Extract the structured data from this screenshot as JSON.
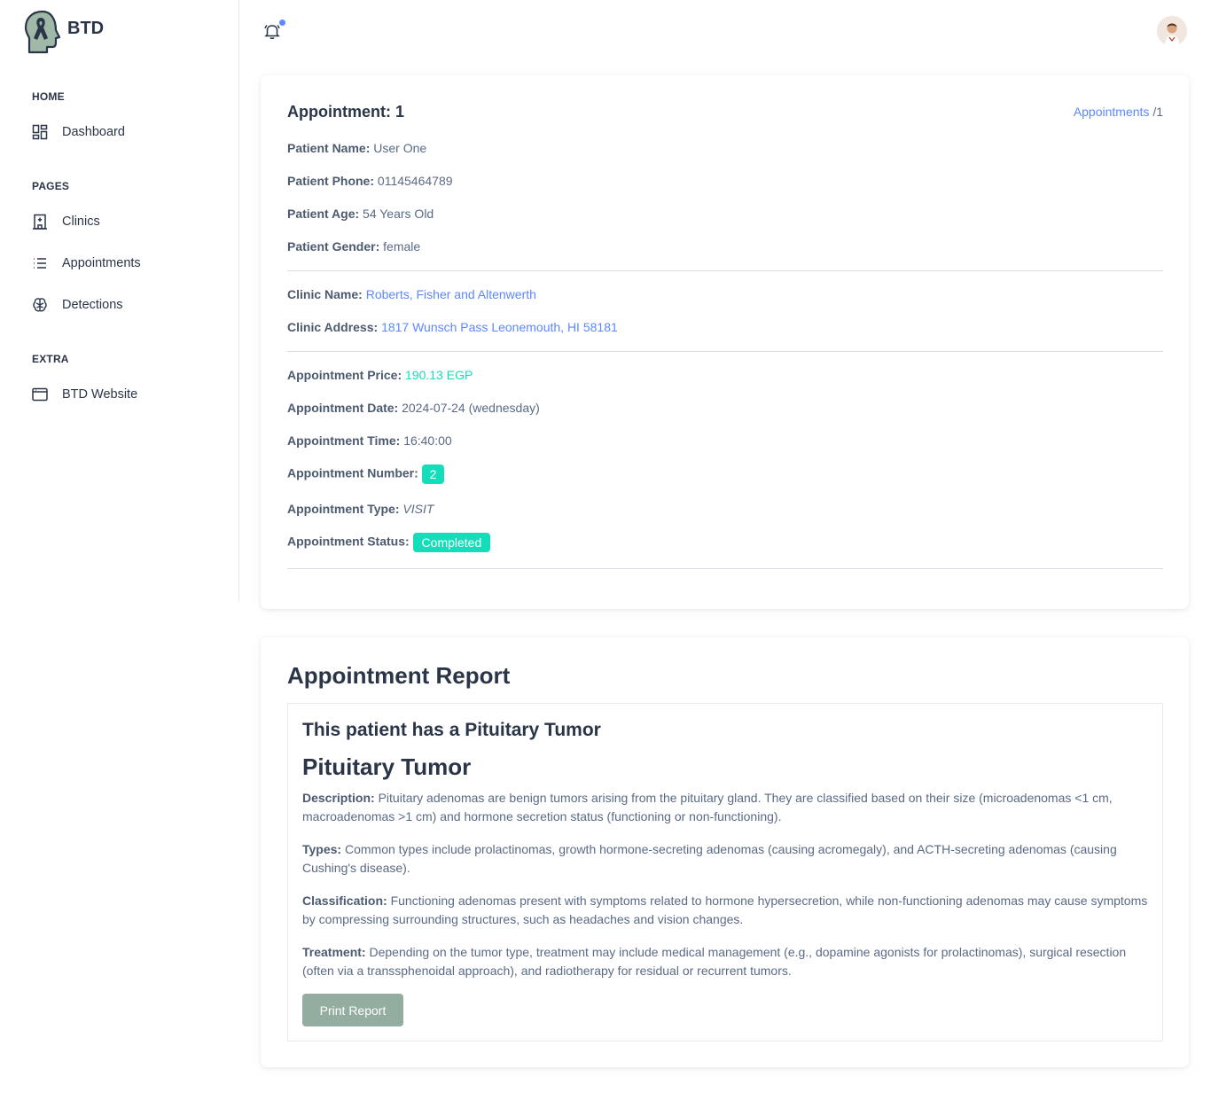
{
  "brand": {
    "name": "BTD"
  },
  "sidebar": {
    "sections": [
      {
        "title": "HOME"
      },
      {
        "title": "PAGES"
      },
      {
        "title": "EXTRA"
      }
    ],
    "items": [
      {
        "label": "Dashboard",
        "icon": "dashboard-icon"
      },
      {
        "label": "Clinics",
        "icon": "building-icon"
      },
      {
        "label": "Appointments",
        "icon": "list-icon"
      },
      {
        "label": "Detections",
        "icon": "brain-icon"
      },
      {
        "label": "BTD Website",
        "icon": "browser-icon"
      }
    ]
  },
  "topbar": {
    "bell_icon": "bell-icon",
    "avatar_icon": "user-avatar"
  },
  "appointment": {
    "title": "Appointment: 1",
    "breadcrumb": {
      "link": "Appointments",
      "separator": "/",
      "current": "1"
    },
    "patient": [
      {
        "label": "Patient Name:",
        "value": "User One"
      },
      {
        "label": "Patient Phone:",
        "value": "01145464789"
      },
      {
        "label": "Patient Age:",
        "value": "54 Years Old"
      },
      {
        "label": "Patient Gender:",
        "value": "female"
      }
    ],
    "clinic": [
      {
        "label": "Clinic Name:",
        "value": "Roberts, Fisher and Altenwerth"
      },
      {
        "label": "Clinic Address:",
        "value": "1817 Wunsch Pass Leonemouth, HI 58181"
      }
    ],
    "details": {
      "price_label": "Appointment Price:",
      "price": "190.13 EGP",
      "date_label": "Appointment Date:",
      "date": "2024-07-24 (wednesday)",
      "time_label": "Appointment Time:",
      "time": "16:40:00",
      "number_label": "Appointment Number:",
      "number": "2",
      "type_label": "Appointment Type:",
      "type": "VISIT",
      "status_label": "Appointment Status:",
      "status": "Completed"
    }
  },
  "report": {
    "title": "Appointment Report",
    "heading": "This patient has a Pituitary Tumor",
    "subtitle": "Pituitary Tumor",
    "paragraphs": [
      {
        "label": "Description:",
        "text": "Pituitary adenomas are benign tumors arising from the pituitary gland. They are classified based on their size (microadenomas <1 cm, macroadenomas >1 cm) and hormone secretion status (functioning or non-functioning)."
      },
      {
        "label": "Types:",
        "text": "Common types include prolactinomas, growth hormone-secreting adenomas (causing acromegaly), and ACTH-secreting adenomas (causing Cushing's disease)."
      },
      {
        "label": "Classification:",
        "text": "Functioning adenomas present with symptoms related to hormone hypersecretion, while non-functioning adenomas may cause symptoms by compressing surrounding structures, such as headaches and vision changes."
      },
      {
        "label": "Treatment:",
        "text": "Depending on the tumor type, treatment may include medical management (e.g., dopamine agonists for prolactinomas), surgical resection (often via a transsphenoidal approach), and radiotherapy for residual or recurrent tumors."
      }
    ],
    "print_label": "Print Report"
  },
  "colors": {
    "primary": "#5d87ff",
    "success": "#13deb9",
    "text": "#2a3547",
    "muted": "#5a6a85",
    "print_button": "#93ada0"
  }
}
